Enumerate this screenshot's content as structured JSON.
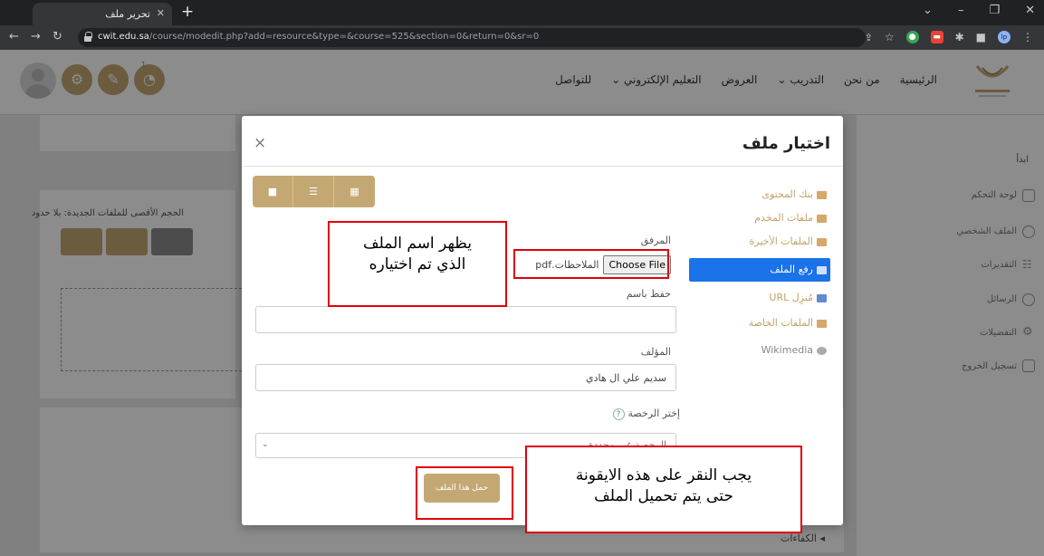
{
  "browser": {
    "tab_title": "تحرير ملف",
    "url_host": "cwit.edu.sa",
    "url_path": "/course/modedit.php?add=resource&type=&course=525&section=0&return=0&sr=0"
  },
  "header": {
    "nav": [
      "الرئيسية",
      "من نحن",
      "التدريب ⌄",
      "العروض",
      "التعليم الإلكتروني ⌄",
      "للتواصل"
    ],
    "notification_count": "1"
  },
  "sidebar": {
    "heading": "ابدأ",
    "items": [
      "لوحة التحكم",
      "الملف الشخصي",
      "التقديرات",
      "الرسائل",
      "التفضيلات",
      "تسجيل الخروج"
    ]
  },
  "background": {
    "max_size_text": "الحجم الأقصى للملفات الجديدة: بلا حدود",
    "bottom_link": "الكفاءات"
  },
  "modal": {
    "title": "اختيار ملف",
    "close": "×",
    "repositories": [
      {
        "label": "بنك المحتوى",
        "active": false
      },
      {
        "label": "ملفات المخدم",
        "active": false
      },
      {
        "label": "الملفات الأخيرة",
        "active": false
      },
      {
        "label": "رفع الملف",
        "active": true
      },
      {
        "label": "مُنزِل URL",
        "active": false
      },
      {
        "label": "الملفات الخاصة",
        "active": false
      },
      {
        "label": "Wikimedia",
        "active": false
      }
    ],
    "attachment_label": "المرفق",
    "choose_file_label": "Choose File",
    "file_name": "الملاحظات.pdf",
    "save_as_label": "حفظ باسم",
    "save_as_value": "",
    "author_label": "المؤلف",
    "author_value": "سديم علي ال هادي",
    "license_label": "إختر الرخصة",
    "license_value": "الرخصة غير محددة",
    "upload_button": "حمل هذا الملف"
  },
  "annotations": {
    "callout_top": [
      "يظهر اسم الملف",
      "الذي تم اختياره"
    ],
    "callout_bottom": [
      "يجب النقر على هذه الايقونة",
      "حتى يتم تحميل الملف"
    ]
  },
  "colors": {
    "accent_gold": "#c4a873",
    "active_blue": "#1a73e8",
    "annotation_red": "#e0000b"
  }
}
